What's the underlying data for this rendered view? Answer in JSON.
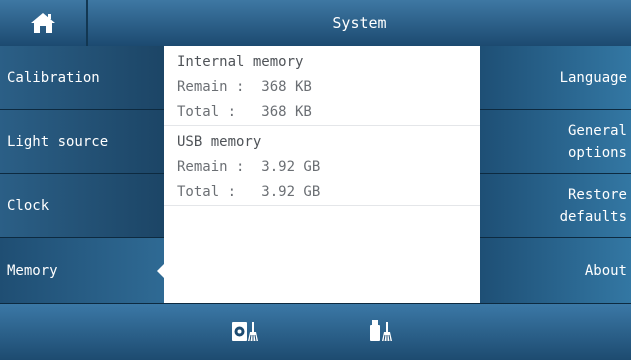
{
  "header": {
    "title": "System",
    "home_icon": "home-icon"
  },
  "left_menu": [
    {
      "label": "Calibration",
      "active": false
    },
    {
      "label": "Light source",
      "active": false
    },
    {
      "label": "Clock",
      "active": false
    },
    {
      "label": "Memory",
      "active": true
    }
  ],
  "right_menu": [
    {
      "label": "Language"
    },
    {
      "label_line1": "General",
      "label_line2": "options"
    },
    {
      "label_line1": "Restore",
      "label_line2": "defaults"
    },
    {
      "label": "About"
    }
  ],
  "memory": {
    "internal": {
      "title": "Internal memory",
      "remain": "Remain :  368 KB",
      "total": "Total :   368 KB"
    },
    "usb": {
      "title": "USB memory",
      "remain": "Remain :  3.92 GB",
      "total": "Total :   3.92 GB"
    }
  },
  "toolbar": {
    "icons": [
      "clean-internal-memory-icon",
      "clean-usb-memory-icon"
    ]
  },
  "colors": {
    "bar_dark": "#1c4a70",
    "bar_light": "#3e78a3",
    "text_white": "#ffffff",
    "content_text": "#6b6f74"
  }
}
